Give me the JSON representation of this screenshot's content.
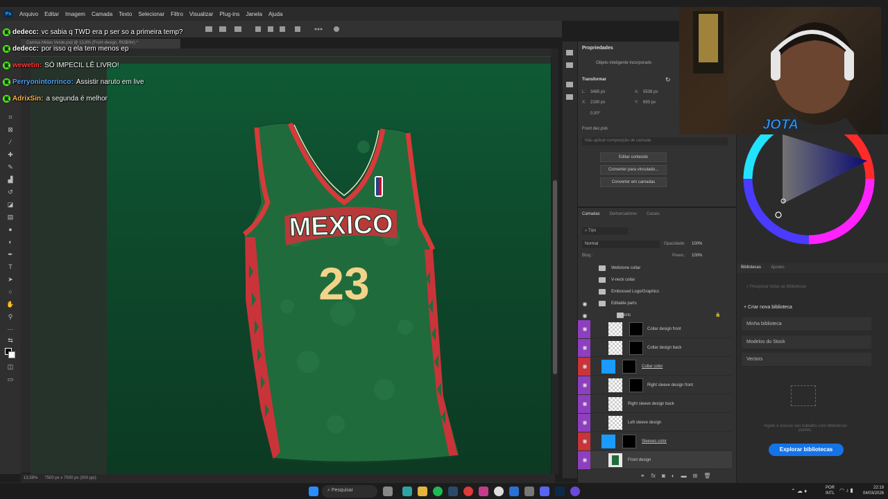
{
  "menubar": {
    "app_icon": "Ps",
    "items": [
      "Arquivo",
      "Editar",
      "Imagem",
      "Camada",
      "Texto",
      "Selecionar",
      "Filtro",
      "Visualizar",
      "Plug-ins",
      "Janela",
      "Ajuda"
    ]
  },
  "document": {
    "tab_title": "Camisa Midas Verde.psd @ 13,6% (Front design, RGB/8#) *",
    "zoom": "13,58%",
    "dimensions": "7500 px x 7500 px (300 ppi)"
  },
  "jersey": {
    "team_text": "MEXICO",
    "number": "23",
    "colors": {
      "body": "#1f6b3c",
      "trim": "#d63a3a",
      "number": "#f2d38a",
      "side_red": "#c8343a"
    }
  },
  "chat": {
    "messages": [
      {
        "user": "dedecc:",
        "text": "vc sabia q TWD era p ser so a primeira temp?",
        "user_color": "#ffffff"
      },
      {
        "user": "dedecc:",
        "text": "por isso q ela tem menos ep",
        "user_color": "#ffffff"
      },
      {
        "user": "wewetin:",
        "text": "SÓ IMPECIL LÊ LIVRO!",
        "user_color": "#ff3b3b"
      },
      {
        "user": "Perryonintorrinco:",
        "text": "Assistir naruto em live",
        "user_color": "#4fa3ff"
      },
      {
        "user": "AdrixSin:",
        "text": "a segunda é melhor",
        "user_color": "#ffb347"
      }
    ]
  },
  "properties": {
    "title": "Propriedades",
    "smart_object": "Objeto inteligente incorporado",
    "transform_label": "Transformar",
    "w": "3485 px",
    "h": "5538 px",
    "x": "2190 px",
    "y": "893 px",
    "angle": "0,00°",
    "source_file": "Front dec.psb",
    "layer_comp": "Não aplicar composição de camada",
    "buttons": [
      "Editar conteúdo",
      "Converter para vinculado...",
      "Converter em camadas"
    ]
  },
  "layers": {
    "tabs": [
      "Camadas",
      "Demarcadores",
      "Canais"
    ],
    "filter": "Tipo",
    "blend_mode": "Normal",
    "opacity_label": "Opacidade:",
    "opacity": "100%",
    "lock_label": "Bloq.:",
    "fill_label": "Preen.:",
    "fill": "100%",
    "groups": [
      "Wellstone collar",
      "V-neck collar",
      "Embossed Logo/Graphics",
      "Editable parts",
      "Effects"
    ],
    "items": [
      {
        "name": "Collar design front",
        "thumb": "check",
        "tag": "#8e3fbf"
      },
      {
        "name": "Collar design back",
        "thumb": "check",
        "tag": "#8e3fbf"
      },
      {
        "name": "Collar color",
        "thumb": "blue",
        "tag": "#c8343a"
      },
      {
        "name": "Right sleeve design front",
        "thumb": "check",
        "tag": "#8e3fbf"
      },
      {
        "name": "Right sleeve design back",
        "thumb": "check",
        "tag": "#8e3fbf"
      },
      {
        "name": "Left sleeve design",
        "thumb": "check",
        "tag": "#8e3fbf"
      },
      {
        "name": "Sleeves color",
        "thumb": "blue",
        "tag": "#c8343a"
      },
      {
        "name": "Front design",
        "thumb": "jersey",
        "tag": "#8e3fbf"
      }
    ]
  },
  "libraries": {
    "tabs": [
      "Bibliotecas",
      "Ajustes"
    ],
    "search_placeholder": "Pesquisar todas as bibliotecas",
    "new_library": "+ Criar nova biblioteca",
    "items": [
      "Minha biblioteca",
      "Modelos do Stock",
      "Vectors"
    ],
    "info": "Ingele e acesse seu trabalho com bibliotecas pontes.",
    "explore_button": "Explorar bibliotecas"
  },
  "webcam": {
    "overlay_text": "JOTA"
  },
  "taskbar": {
    "search_placeholder": "Pesquisar",
    "lang_top": "POR",
    "lang_bottom": "INTL",
    "time": "22:19",
    "date": "04/03/2026"
  }
}
